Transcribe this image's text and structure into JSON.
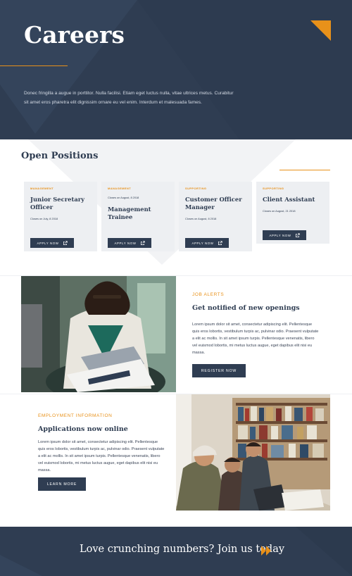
{
  "hero": {
    "title": "Careers",
    "text": "Donec fringilla a augue in porttitor. Nulla facilisi. Etiam eget luctus nulla, vitae ultrices metus. Curabitur sit amet eros pharetra elit dignissim ornare eu vel enim. Interdum et malesuada fames."
  },
  "positions": {
    "title": "Open Positions",
    "cards": [
      {
        "category": "MANAGEMENT",
        "title": "Junior Secretary Officer",
        "date": "Closes on July, 8 2018",
        "button": "APPLY NOW"
      },
      {
        "category": "MANAGEMENT",
        "title": "Management Trainee",
        "date": "Closes on August, 8 2018",
        "button": "APPLY NOW"
      },
      {
        "category": "SUPPORTING",
        "title": "Customer Officer Manager",
        "date": "Closes on August, 8 2018",
        "button": "APPLY NOW"
      },
      {
        "category": "SUPPORTING",
        "title": "Client Assistant",
        "date": "Closes on August, 21 2018",
        "button": "APPLY NOW"
      }
    ]
  },
  "alerts": {
    "label": "JOB ALERTS",
    "title": "Get notified of new openings",
    "text": "Lorem ipsum dolor sit amet, consectetur adipiscing elit. Pellentesque quis eros lobortis, vestibulum turpis ac, pulvinar odio. Praesent vulputate a elit ac mollis. In sit amet ipsum turpis. Pellentesque venenatis, libero vel euismod lobortis, mi metus luctus augue, eget dapibus elit nisi eu massa.",
    "button": "REGISTER NOW"
  },
  "employment": {
    "label": "EMPLOYMENT INFORMATION",
    "title": "Applications now online",
    "text": "Lorem ipsum dolor sit amet, consectetur adipiscing elit. Pellentesque quis eros lobortis, vestibulum turpis ac, pulvinar odio. Praesent vulputate a elit ac mollis. In sit amet ipsum turpis. Pellentesque venenatis, libero vel euismod lobortis, mi metus luctus augue, eget dapibus elit nisi eu massa.",
    "button": "LEARN MORE"
  },
  "cta": {
    "text": "Love crunching numbers? Join us today"
  },
  "colors": {
    "navy": "#2f3d52",
    "accent": "#e8911a",
    "card": "#edeff2"
  },
  "icons": [
    "external-link-icon",
    "double-chevron-right-icon",
    "corner-triangle-icon"
  ]
}
